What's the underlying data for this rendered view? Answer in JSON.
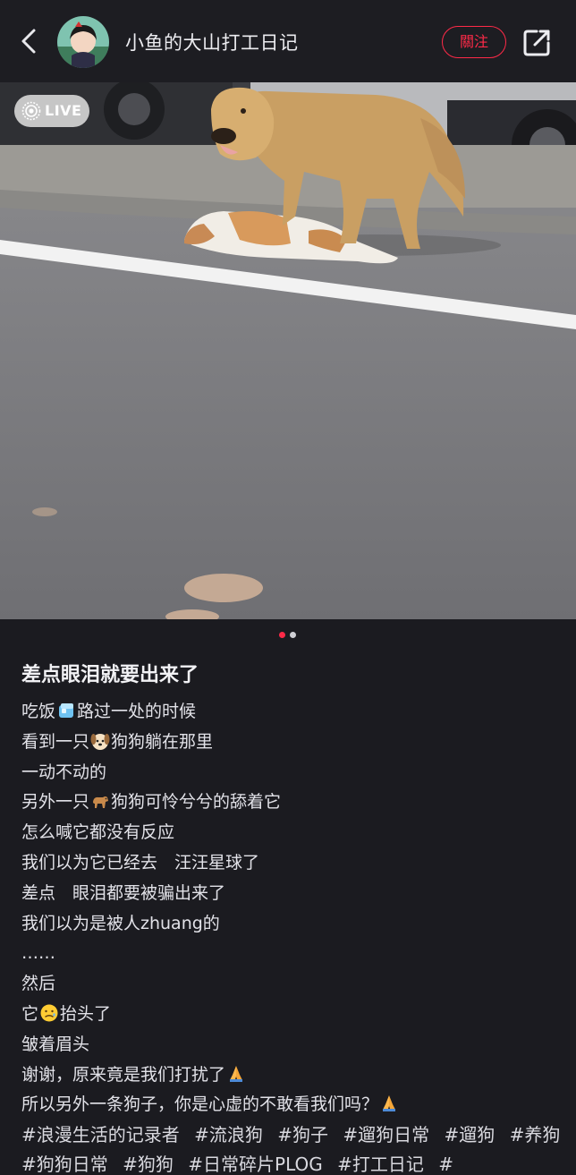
{
  "header": {
    "author_name": "小鱼的大山打工日记",
    "follow_label": "關注",
    "icons": {
      "back": "chevron-left-icon",
      "share": "share-icon"
    }
  },
  "photo": {
    "live_label": "LIVE",
    "page_count": 2,
    "current_page": 1
  },
  "post": {
    "title": "差点眼泪就要出来了",
    "lines": [
      [
        "吃饭",
        "ice-cube-emoji",
        "路过一处的时候"
      ],
      [
        "看到一只",
        "dog-face-emoji",
        "狗狗躺在那里"
      ],
      [
        "一动不动的"
      ],
      [
        "另外一只",
        "dog-emoji",
        "狗狗可怜兮兮的舔着它"
      ],
      [
        "怎么喊它都没有反应"
      ],
      [
        "我们以为它已经去　汪汪星球了"
      ],
      [
        "差点　眼泪都要被骗出来了"
      ],
      [
        "我们以为是被人zhuang的"
      ],
      [
        "……"
      ],
      [
        "然后"
      ],
      [
        "它",
        "sad-face-emoji",
        "抬头了"
      ],
      [
        "皱着眉头"
      ],
      [
        "谢谢，原来竟是我们打扰了",
        "folded-hands-emoji"
      ],
      [
        "所以另外一条狗子，你是心虚的不敢看我们吗？",
        "folded-hands-emoji"
      ]
    ],
    "tags": [
      "#浪漫生活的记录者",
      "#流浪狗",
      "#狗子",
      "#遛狗日常",
      "#遛狗",
      "#养狗",
      "#狗狗日常",
      "#狗狗",
      "#日常碎片PLOG",
      "#打工日记",
      "#"
    ]
  },
  "colors": {
    "accent": "#ff2a48",
    "background": "#1b1b20"
  }
}
